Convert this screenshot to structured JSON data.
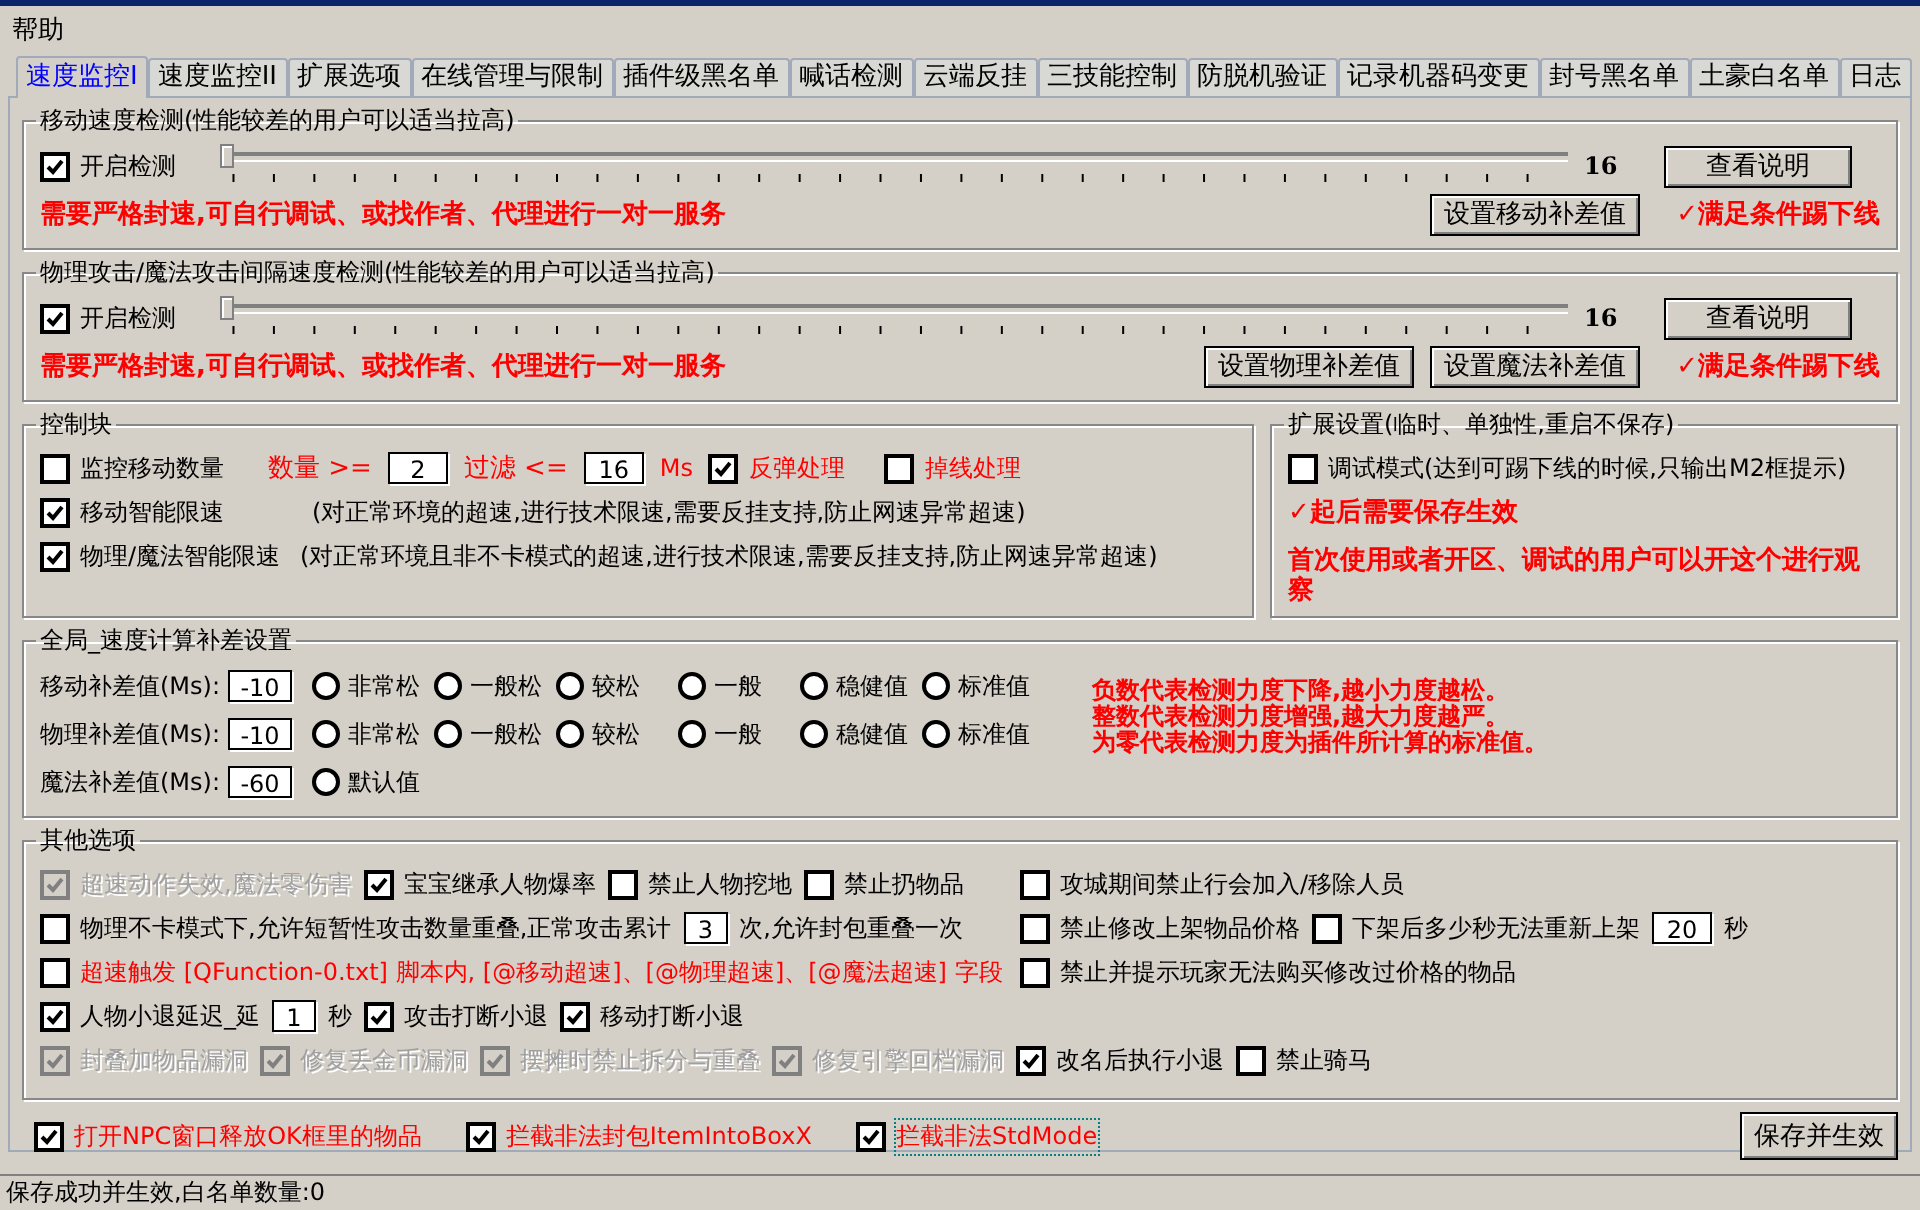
{
  "menu": [
    "帮助"
  ],
  "tabs": [
    {
      "label": "速度监控I",
      "selected": true
    },
    {
      "label": "速度监控II",
      "selected": false
    },
    {
      "label": "扩展选项",
      "selected": false
    },
    {
      "label": "在线管理与限制",
      "selected": false
    },
    {
      "label": "插件级黑名单",
      "selected": false
    },
    {
      "label": "喊话检测",
      "selected": false
    },
    {
      "label": "云端反挂",
      "selected": false
    },
    {
      "label": "三技能控制",
      "selected": false
    },
    {
      "label": "防脱机验证",
      "selected": false
    },
    {
      "label": "记录机器码变更",
      "selected": false
    },
    {
      "label": "封号黑名单",
      "selected": false
    },
    {
      "label": "土豪白名单",
      "selected": false
    },
    {
      "label": "日志",
      "selected": false
    }
  ],
  "speed_groups": [
    {
      "title": "移动速度检测(性能较差的用户可以适当拉高)",
      "enabled": {
        "label": "开启检测",
        "checked": true
      },
      "slider": {
        "level": 0,
        "reading": "16"
      },
      "help_button": "查看说明",
      "note": "需要严格封速,可自行调试、或找作者、代理进行一对一服务",
      "buttons": [
        "设置移动补差值"
      ],
      "kick": "✓满足条件踢下线"
    },
    {
      "title": "物理攻击/魔法攻击间隔速度检测(性能较差的用户可以适当拉高)",
      "enabled": {
        "label": "开启检测",
        "checked": true
      },
      "slider": {
        "level": 0,
        "reading": "16"
      },
      "help_button": "查看说明",
      "note": "需要严格封速,可自行调试、或找作者、代理进行一对一服务",
      "buttons": [
        "设置物理补差值",
        "设置魔法补差值"
      ],
      "kick": "✓满足条件踢下线"
    }
  ],
  "control_block": {
    "title": "控制块",
    "monitor": {
      "label": "监控移动数量",
      "checked": false
    },
    "count_label": "数量 >=",
    "count": "2",
    "filter_label": "过滤 <=",
    "filter": "16",
    "unit": "Ms",
    "bounce": {
      "label": "反弹处理",
      "checked": true
    },
    "disconnect": {
      "label": "掉线处理",
      "checked": false
    },
    "limits": [
      {
        "label": "移动智能限速",
        "checked": true,
        "note": "(对正常环境的超速,进行技术限速,需要反挂支持,防止网速异常超速)"
      },
      {
        "label": "物理/魔法智能限速",
        "checked": true,
        "note": "(对正常环境且非不卡模式的超速,进行技术限速,需要反挂支持,防止网速异常超速)"
      }
    ]
  },
  "extension": {
    "title": "扩展设置(临时、单独性,重启不保存)",
    "debug": {
      "label": "调试模式(达到可踢下线的时候,只输出M2框提示)",
      "checked": false
    },
    "notes": [
      "✓起后需要保存生效",
      "首次使用或者开区、调试的用户可以开这个进行观察"
    ]
  },
  "compensation": {
    "title": "全局_速度计算补差设置",
    "rows": [
      {
        "label": "移动补差值(Ms):",
        "value": "-10",
        "options": [
          {
            "label": "非常松",
            "selected": false
          },
          {
            "label": "一般松",
            "selected": false
          },
          {
            "label": "较松",
            "selected": false
          },
          {
            "label": "一般",
            "selected": false
          },
          {
            "label": "稳健值",
            "selected": false
          },
          {
            "label": "标准值",
            "selected": false
          }
        ]
      },
      {
        "label": "物理补差值(Ms):",
        "value": "-10",
        "options": [
          {
            "label": "非常松",
            "selected": false
          },
          {
            "label": "一般松",
            "selected": false
          },
          {
            "label": "较松",
            "selected": false
          },
          {
            "label": "一般",
            "selected": false
          },
          {
            "label": "稳健值",
            "selected": false
          },
          {
            "label": "标准值",
            "selected": false
          }
        ]
      },
      {
        "label": "魔法补差值(Ms):",
        "value": "-60",
        "options": [
          {
            "label": "默认值",
            "selected": false
          }
        ]
      }
    ],
    "notes": [
      "负数代表检测力度下降,越小力度越松。",
      "整数代表检测力度增强,越大力度越严。",
      "为零代表检测力度为插件所计算的标准值。"
    ]
  },
  "other_options": {
    "title": "其他选项",
    "rows": [
      {
        "left": [
          {
            "kind": "check",
            "label": "超速动作失效,魔法零伤害",
            "checked": true,
            "disabled": true,
            "emphasis": false
          },
          {
            "kind": "check",
            "label": "宝宝继承人物爆率",
            "checked": true,
            "disabled": false,
            "emphasis": false
          },
          {
            "kind": "check",
            "label": "禁止人物挖地",
            "checked": false,
            "disabled": false,
            "emphasis": false
          },
          {
            "kind": "check",
            "label": "禁止扔物品",
            "checked": false,
            "disabled": false,
            "emphasis": false
          }
        ],
        "right": [
          {
            "kind": "check",
            "label": "攻城期间禁止行会加入/移除人员",
            "checked": false,
            "disabled": false,
            "emphasis": false
          }
        ]
      },
      {
        "left": [
          {
            "kind": "check",
            "label": "物理不卡模式下,允许短暂性攻击数量重叠,正常攻击累计",
            "checked": false,
            "disabled": false,
            "emphasis": false
          },
          {
            "kind": "field",
            "value": "3"
          },
          {
            "kind": "text",
            "label": "次,允许封包重叠一次"
          }
        ],
        "right": [
          {
            "kind": "check",
            "label": "禁止修改上架物品价格",
            "checked": false,
            "disabled": false,
            "emphasis": false
          },
          {
            "kind": "check",
            "label": "下架后多少秒无法重新上架",
            "checked": false,
            "disabled": false,
            "emphasis": false
          },
          {
            "kind": "field",
            "value": "20"
          },
          {
            "kind": "text",
            "label": "秒"
          }
        ]
      },
      {
        "left": [
          {
            "kind": "check",
            "label": "超速触发 [QFunction-0.txt] 脚本内, [@移动超速]、[@物理超速]、[@魔法超速] 字段",
            "checked": false,
            "disabled": false,
            "emphasis": true
          }
        ],
        "right": [
          {
            "kind": "check",
            "label": "禁止并提示玩家无法购买修改过价格的物品",
            "checked": false,
            "disabled": false,
            "emphasis": false
          }
        ]
      },
      {
        "left": [
          {
            "kind": "check",
            "label": "人物小退延迟_延",
            "checked": true,
            "disabled": false,
            "emphasis": false
          },
          {
            "kind": "field",
            "value": "1"
          },
          {
            "kind": "text",
            "label": "秒"
          },
          {
            "kind": "check",
            "label": "攻击打断小退",
            "checked": true,
            "disabled": false,
            "emphasis": false
          },
          {
            "kind": "check",
            "label": "移动打断小退",
            "checked": true,
            "disabled": false,
            "emphasis": false
          }
        ]
      },
      {
        "left": [
          {
            "kind": "check",
            "label": "封叠加物品漏洞",
            "checked": true,
            "disabled": true,
            "emphasis": false
          },
          {
            "kind": "check",
            "label": "修复丢金币漏洞",
            "checked": true,
            "disabled": true,
            "emphasis": false
          },
          {
            "kind": "check",
            "label": "摆摊时禁止拆分与重叠",
            "checked": true,
            "disabled": true,
            "emphasis": false
          },
          {
            "kind": "check",
            "label": "修复引擎回档漏洞",
            "checked": true,
            "disabled": true,
            "emphasis": false
          },
          {
            "kind": "check",
            "label": "改名后执行小退",
            "checked": true,
            "disabled": false,
            "emphasis": false
          },
          {
            "kind": "check",
            "label": "禁止骑马",
            "checked": false,
            "disabled": false,
            "emphasis": false
          }
        ]
      }
    ]
  },
  "bottom_options": [
    {
      "label": "打开NPC窗口释放OK框里的物品",
      "checked": true,
      "focused": false
    },
    {
      "label": "拦截非法封包ItemIntoBoxX",
      "checked": true,
      "focused": false
    },
    {
      "label": "拦截非法StdMode",
      "checked": true,
      "focused": true
    }
  ],
  "save_button": "保存并生效",
  "status_bar": "保存成功并生效,白名单数量:0"
}
